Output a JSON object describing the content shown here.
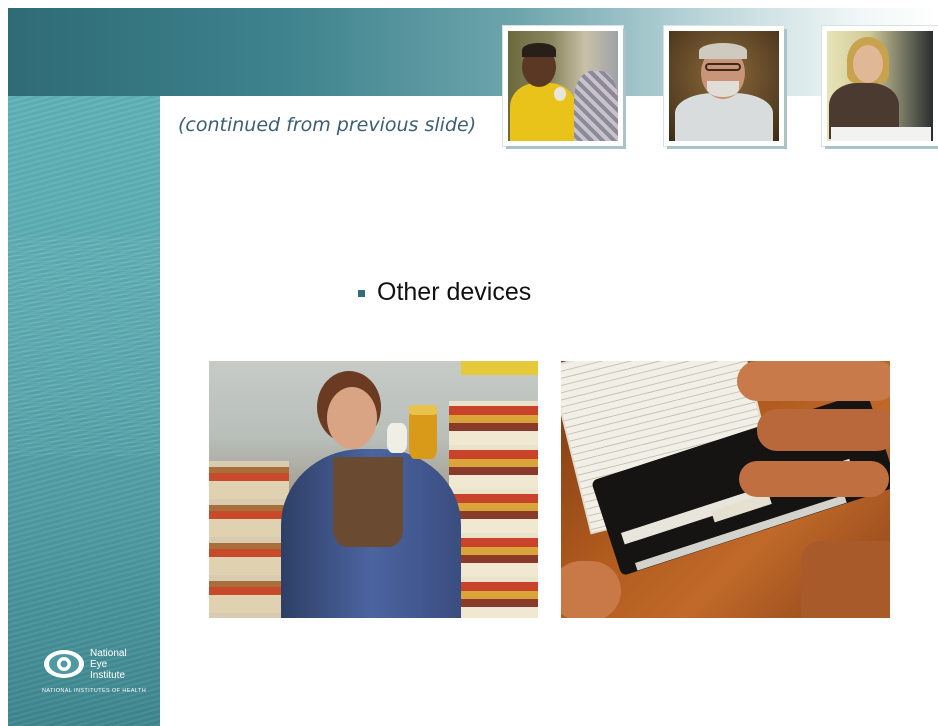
{
  "slide": {
    "subtitle": "(continued from previous slide)",
    "bullets": [
      {
        "text": "Other devices"
      }
    ],
    "photos": {
      "header": [
        {
          "icon": "woman-reading-label-photo"
        },
        {
          "icon": "man-with-glasses-photo"
        },
        {
          "icon": "woman-at-desk-photo"
        }
      ],
      "main": [
        {
          "icon": "woman-using-magnifier-in-store-photo"
        },
        {
          "icon": "hands-with-reading-guide-photo"
        }
      ]
    },
    "logo": {
      "line1": "National",
      "line2": "Eye",
      "line3": "Institute",
      "subtext": "NATIONAL INSTITUTES OF HEALTH"
    },
    "colors": {
      "header_start": "#2e6b76",
      "teal_bar": "#5aa9af",
      "subtitle_text": "#3d5f74",
      "bullet_marker": "#2f6f7b"
    }
  }
}
